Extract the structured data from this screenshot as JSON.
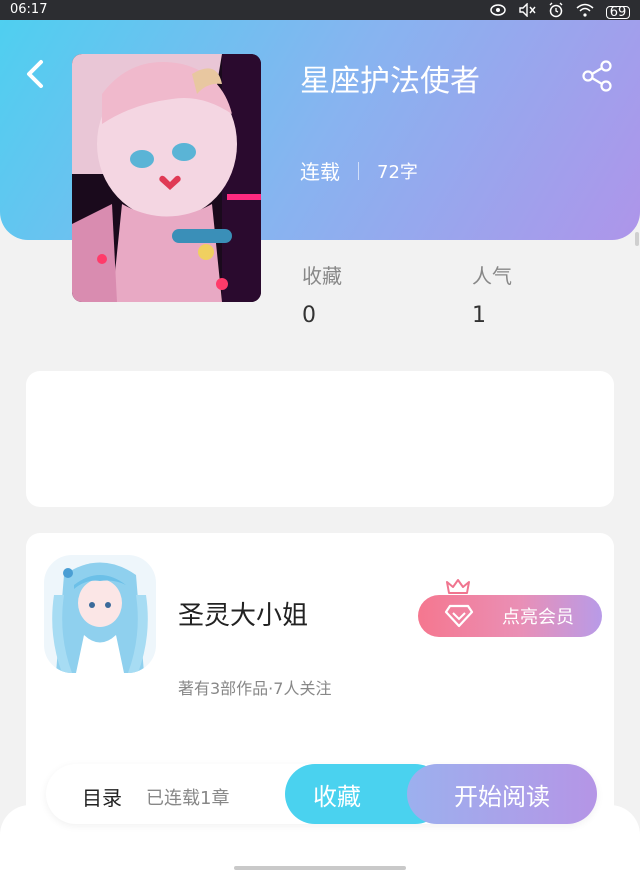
{
  "status_bar": {
    "time": "06:17",
    "battery": "69"
  },
  "book": {
    "title": "星座护法使者",
    "status": "连载",
    "word_count": "72字",
    "stats": {
      "favorites_label": "收藏",
      "favorites_value": "0",
      "popularity_label": "人气",
      "popularity_value": "1"
    }
  },
  "author": {
    "name": "圣灵大小姐",
    "stats": "著有3部作品·7人关注",
    "vip_label": "点亮会员"
  },
  "action_bar": {
    "catalog_label": "目录",
    "chapters_label": "已连载1章",
    "collect_label": "收藏",
    "read_label": "开始阅读"
  },
  "colors": {
    "header_start": "#4fcff0",
    "header_end": "#ae95ea",
    "collect": "#4ad2ef",
    "vip": "#f5778f"
  }
}
